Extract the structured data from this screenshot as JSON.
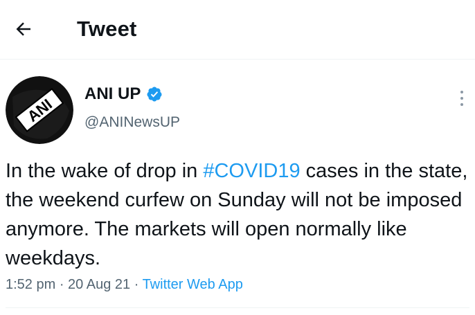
{
  "header": {
    "back_icon": "arrow-left-icon",
    "title": "Tweet"
  },
  "tweet": {
    "avatar_text": "ANI",
    "author_name": "ANI UP",
    "verified_icon": "verified-badge-icon",
    "verified_color": "#1d9bf0",
    "handle": "@ANINewsUP",
    "more_icon": "more-vertical-icon",
    "text_before": "In the wake of drop in ",
    "hashtag": "#COVID19",
    "text_after": " cases in the state, the weekend curfew on Sunday will not be imposed anymore. The markets will open normally like weekdays.",
    "time": "1:52 pm",
    "separator": " · ",
    "date": "20 Aug 21",
    "source": "Twitter Web App"
  },
  "colors": {
    "accent": "#1d9bf0",
    "text": "#0f1419",
    "secondary": "#536471"
  }
}
